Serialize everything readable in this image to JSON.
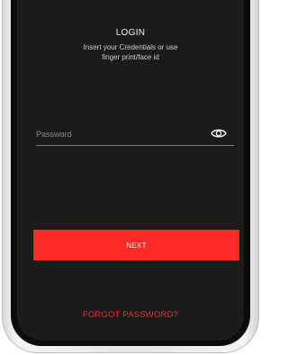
{
  "login": {
    "title": "LOGIN",
    "subtitle_line1": "Insert your Credentials or use",
    "subtitle_line2": "finger print/face id",
    "password_placeholder": "Password",
    "eye_icon": "eye-icon",
    "next_label": "NEXT",
    "forgot_label": "FORGOT PASSWORD?"
  },
  "colors": {
    "background": "#1b1b1b",
    "accent": "#ff2a25",
    "forgot_text": "#e8302a"
  }
}
